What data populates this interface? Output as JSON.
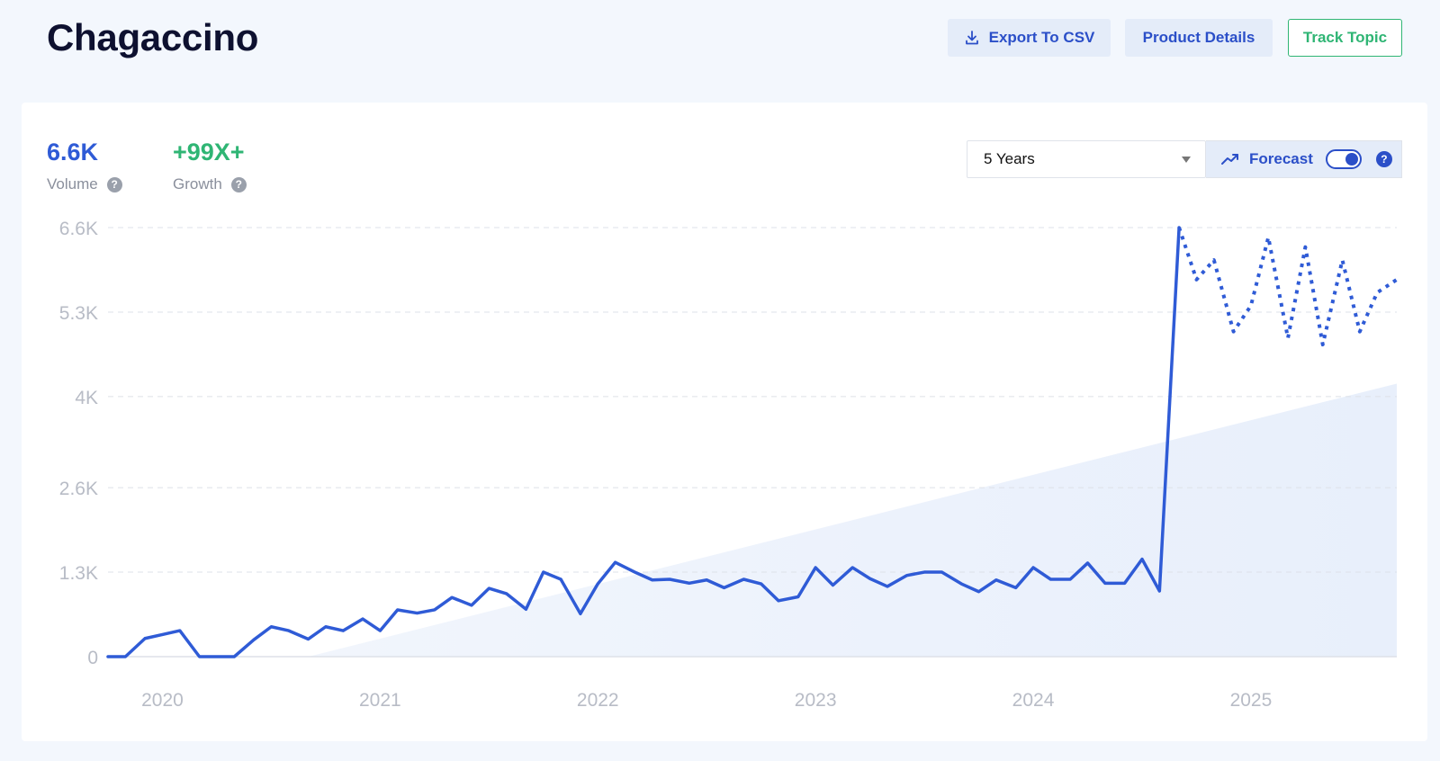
{
  "header": {
    "title": "Chagaccino",
    "export_label": "Export To CSV",
    "product_details_label": "Product Details",
    "track_topic_label": "Track Topic"
  },
  "stats": {
    "volume_value": "6.6K",
    "volume_label": "Volume",
    "growth_value": "+99X+",
    "growth_label": "Growth"
  },
  "controls": {
    "range_selected": "5 Years",
    "forecast_label": "Forecast",
    "forecast_enabled": true
  },
  "colors": {
    "line": "#2f5bd6",
    "growth": "#2fb574",
    "trend_fill": "#e8effb",
    "grid": "#dde1e8",
    "axis_text": "#b8bcc6"
  },
  "icons": {
    "export": "download-icon",
    "forecast": "trend-up-icon",
    "help": "question-icon",
    "caret": "chevron-down-icon"
  },
  "chart_data": {
    "type": "line",
    "y_ticks": [
      "0",
      "1.3K",
      "2.6K",
      "4K",
      "5.3K",
      "6.6K"
    ],
    "y_tick_values": [
      0,
      1300,
      2600,
      4000,
      5300,
      6600
    ],
    "ylim": [
      0,
      6600
    ],
    "x_ticks": [
      "2020",
      "2021",
      "2022",
      "2023",
      "2024",
      "2025"
    ],
    "x_tick_values": [
      2020.0,
      2021.0,
      2022.0,
      2023.0,
      2024.0,
      2025.0
    ],
    "xlim": [
      2019.75,
      2025.67
    ],
    "grid": true,
    "series": [
      {
        "style": "solid",
        "x": [
          2019.75,
          2019.83,
          2019.92,
          2020.0,
          2020.08,
          2020.17,
          2020.25,
          2020.33,
          2020.42,
          2020.5,
          2020.58,
          2020.67,
          2020.75,
          2020.83,
          2020.92,
          2021.0,
          2021.08,
          2021.17,
          2021.25,
          2021.33,
          2021.42,
          2021.5,
          2021.58,
          2021.67,
          2021.75,
          2021.83,
          2021.92,
          2022.0,
          2022.08,
          2022.17,
          2022.25,
          2022.33,
          2022.42,
          2022.5,
          2022.58,
          2022.67,
          2022.75,
          2022.83,
          2022.92,
          2023.0,
          2023.08,
          2023.17,
          2023.25,
          2023.33,
          2023.42,
          2023.5,
          2023.58,
          2023.67,
          2023.75,
          2023.83,
          2023.92,
          2024.0,
          2024.08,
          2024.17,
          2024.25,
          2024.33,
          2024.42,
          2024.5,
          2024.58,
          2024.67
        ],
        "y": [
          0,
          0,
          280,
          340,
          400,
          0,
          0,
          0,
          260,
          460,
          400,
          270,
          460,
          400,
          580,
          400,
          720,
          670,
          720,
          910,
          790,
          1050,
          970,
          730,
          1300,
          1190,
          660,
          1120,
          1450,
          1300,
          1180,
          1190,
          1130,
          1180,
          1060,
          1190,
          1120,
          860,
          920,
          1370,
          1100,
          1370,
          1200,
          1080,
          1250,
          1300,
          1300,
          1120,
          1000,
          1180,
          1060,
          1370,
          1190,
          1190,
          1440,
          1130,
          1130,
          1500,
          1010,
          6600
        ]
      },
      {
        "style": "dashed",
        "x": [
          2024.67,
          2024.75,
          2024.83,
          2024.92,
          2025.0,
          2025.08,
          2025.17,
          2025.25,
          2025.33,
          2025.42,
          2025.5,
          2025.58,
          2025.67
        ],
        "y": [
          6600,
          5800,
          6100,
          5000,
          5400,
          6450,
          4900,
          6300,
          4800,
          6100,
          5000,
          5600,
          5800
        ]
      }
    ],
    "trend": {
      "x": [
        2020.67,
        2025.67
      ],
      "y": [
        0,
        4200
      ]
    }
  }
}
